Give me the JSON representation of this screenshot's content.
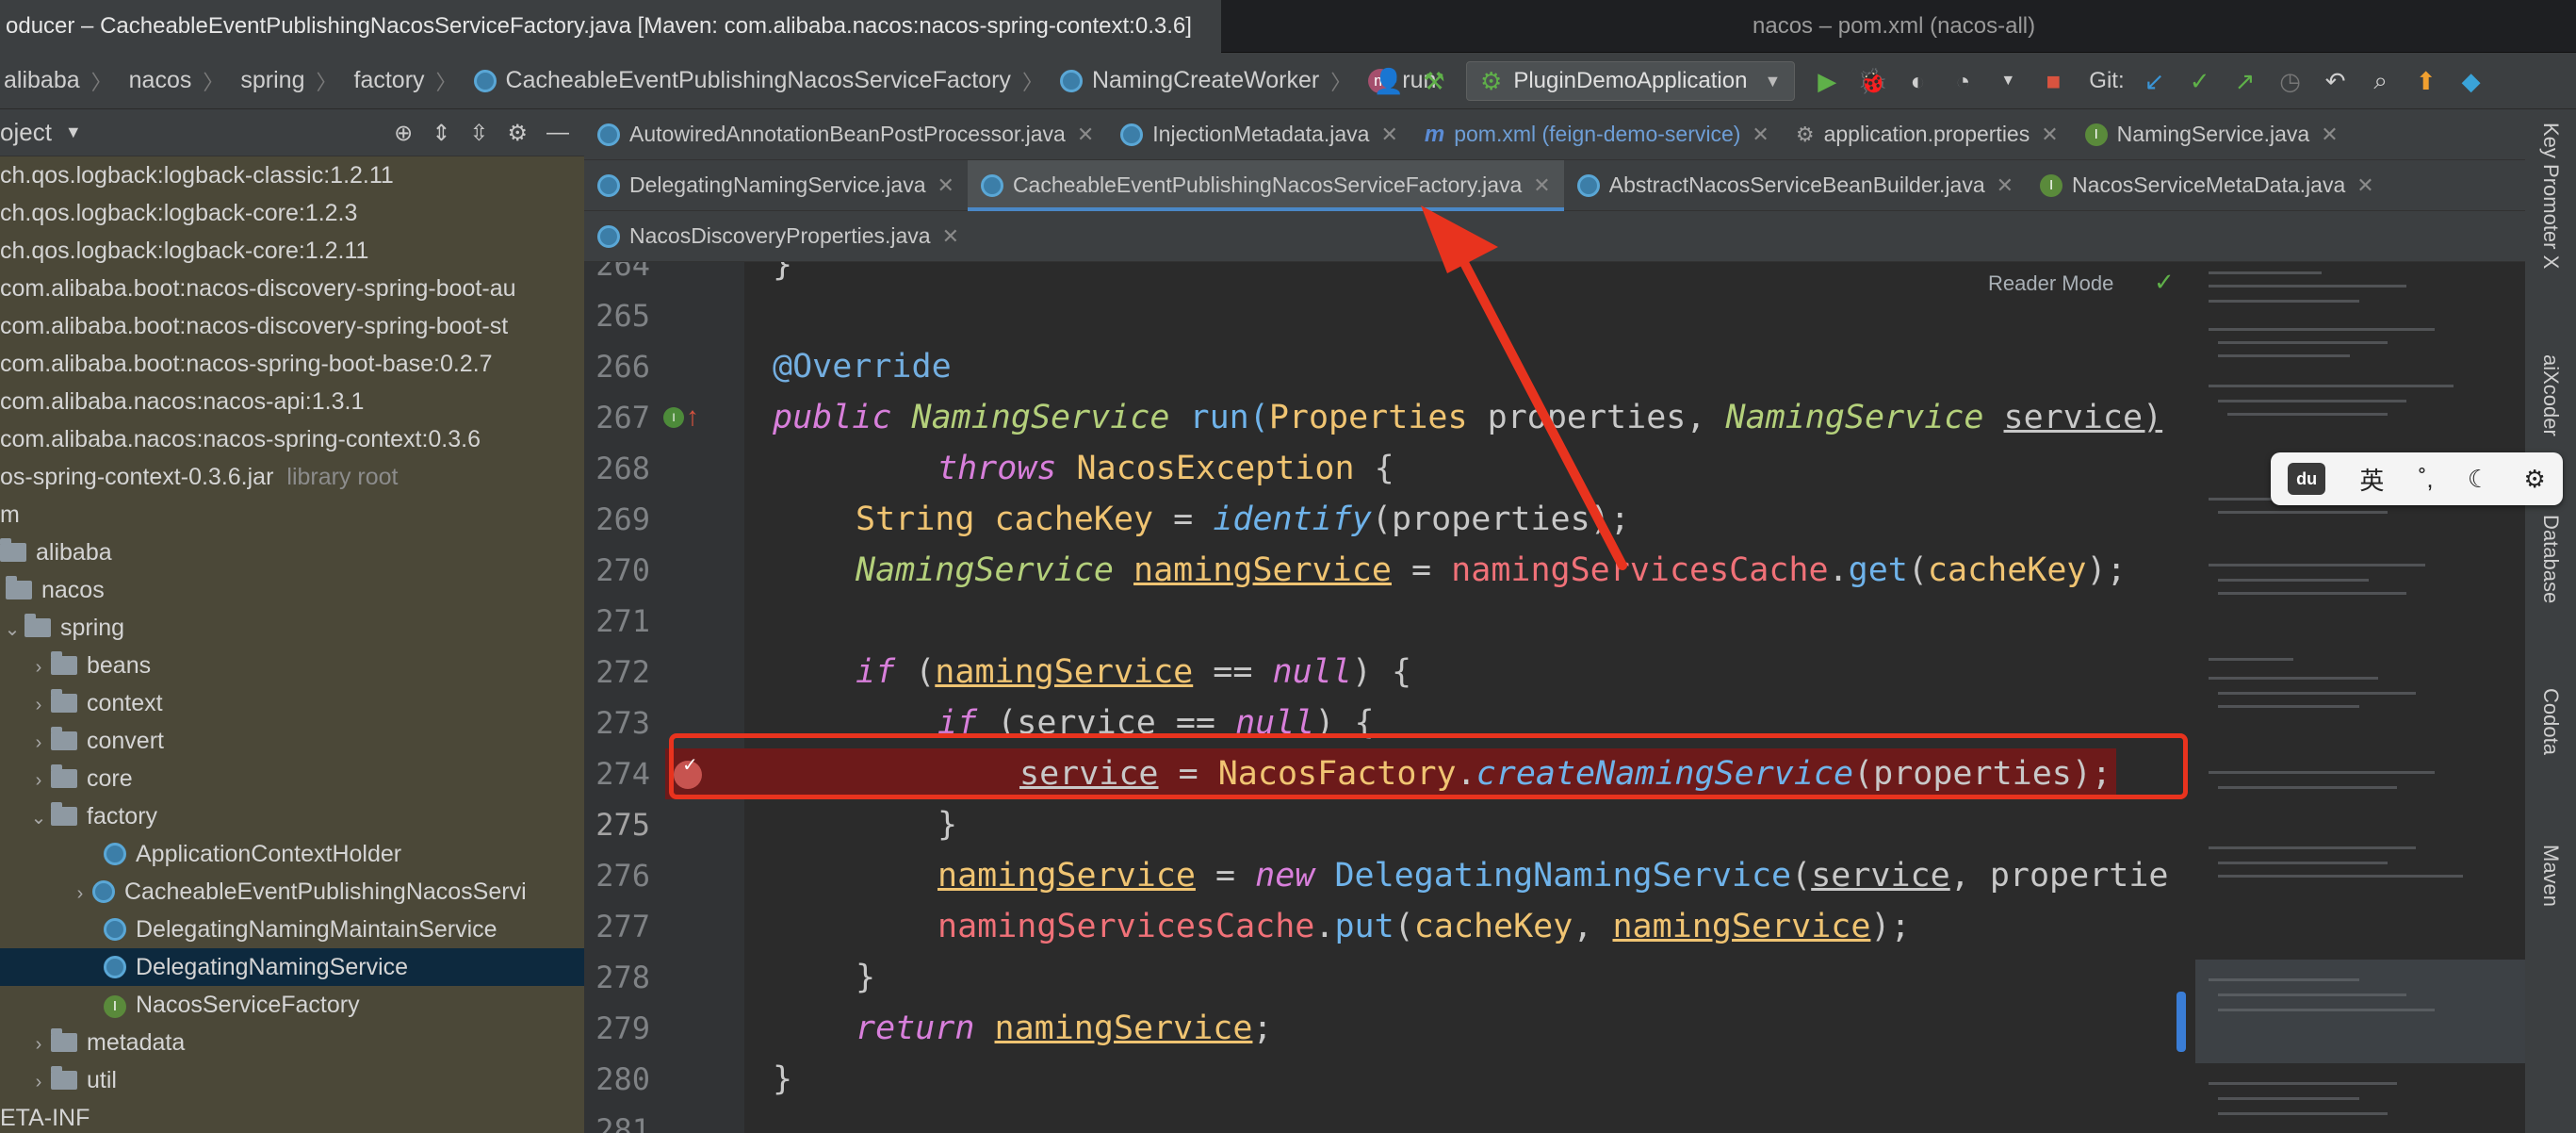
{
  "window": {
    "title": "oducer – CacheableEventPublishingNacosServiceFactory.java [Maven: com.alibaba.nacos:nacos-spring-context:0.3.6]",
    "right_title": "nacos – pom.xml (nacos-all)"
  },
  "breadcrumbs": [
    "alibaba",
    "nacos",
    "spring",
    "factory",
    "CacheableEventPublishingNacosServiceFactory",
    "NamingCreateWorker",
    "run"
  ],
  "toolbar": {
    "run_config": "PluginDemoApplication",
    "git_label": "Git:"
  },
  "project": {
    "title": "oject",
    "rows": [
      {
        "text": "ch.qos.logback:logback-classic:1.2.11",
        "type": "lib"
      },
      {
        "text": "ch.qos.logback:logback-core:1.2.3",
        "type": "lib"
      },
      {
        "text": "ch.qos.logback:logback-core:1.2.11",
        "type": "lib"
      },
      {
        "text": "com.alibaba.boot:nacos-discovery-spring-boot-au",
        "type": "lib"
      },
      {
        "text": "com.alibaba.boot:nacos-discovery-spring-boot-st",
        "type": "lib"
      },
      {
        "text": "com.alibaba.boot:nacos-spring-boot-base:0.2.7",
        "type": "lib"
      },
      {
        "text": "com.alibaba.nacos:nacos-api:1.3.1",
        "type": "lib"
      },
      {
        "text": "com.alibaba.nacos:nacos-spring-context:0.3.6",
        "type": "lib"
      },
      {
        "text": "os-spring-context-0.3.6.jar",
        "type": "lib",
        "muted": "library root"
      },
      {
        "text": "m",
        "type": "lib"
      },
      {
        "text": "alibaba",
        "type": "lib"
      },
      {
        "text": "nacos",
        "type": "lib"
      },
      {
        "text": "spring",
        "type": "lib"
      },
      {
        "text": "beans",
        "type": "lib"
      },
      {
        "text": "context",
        "type": "lib"
      },
      {
        "text": "convert",
        "type": "lib"
      },
      {
        "text": "core",
        "type": "lib"
      },
      {
        "text": "factory",
        "type": "lib"
      },
      {
        "text": "ApplicationContextHolder",
        "type": "lib"
      },
      {
        "text": "CacheableEventPublishingNacosServi",
        "type": "lib"
      },
      {
        "text": "DelegatingNamingMaintainService",
        "type": "lib"
      },
      {
        "text": "DelegatingNamingService",
        "type": "sel"
      },
      {
        "text": "NacosServiceFactory",
        "type": "lib"
      },
      {
        "text": "metadata",
        "type": "lib"
      },
      {
        "text": "util",
        "type": "lib"
      },
      {
        "text": "ETA-INF",
        "type": "lib"
      }
    ]
  },
  "tabs": {
    "row1": [
      "AutowiredAnnotationBeanPostProcessor.java",
      "InjectionMetadata.java",
      "pom.xml (feign-demo-service)",
      "application.properties",
      "NamingService.java"
    ],
    "row2": [
      "DelegatingNamingService.java",
      "CacheableEventPublishingNacosServiceFactory.java",
      "AbstractNacosServiceBeanBuilder.java",
      "NacosServiceMetaData.java"
    ],
    "row3": [
      "NacosDiscoveryProperties.java"
    ]
  },
  "editor": {
    "reader_mode": "Reader Mode",
    "line_numbers": [
      "264",
      "265",
      "266",
      "267",
      "268",
      "269",
      "270",
      "271",
      "272",
      "273",
      "274",
      "275",
      "276",
      "277",
      "278",
      "279",
      "280",
      "281"
    ],
    "lines": {
      "l266": "@Override",
      "l267_a": "public ",
      "l267_b": "NamingService ",
      "l267_c": "run(",
      "l267_d": "Properties ",
      "l267_e": "properties, ",
      "l267_f": "NamingService ",
      "l267_g": "service)",
      "l268_a": "throws ",
      "l268_b": "NacosException ",
      "l268_c": "{",
      "l269_a": "String ",
      "l269_b": "cacheKey ",
      "l269_c": "= ",
      "l269_d": "identify",
      "l269_e": "(properties);",
      "l270_a": "NamingService ",
      "l270_b": "namingService",
      "l270_c": " = ",
      "l270_d": "namingServicesCache",
      "l270_e": ".",
      "l270_f": "get",
      "l270_g": "(",
      "l270_h": "cacheKey",
      "l270_i": ");",
      "l272_a": "if ",
      "l272_b": "(",
      "l272_c": "namingService",
      "l272_d": " == ",
      "l272_e": "null",
      "l272_f": ") {",
      "l273_a": "if ",
      "l273_b": "(service == ",
      "l273_c": "null",
      "l273_d": ") {",
      "l274_a": "service",
      "l274_b": " = ",
      "l274_c": "NacosFactory",
      "l274_d": ".",
      "l274_e": "createNamingService",
      "l274_f": "(properties);",
      "l275": "}",
      "l276_a": "namingService",
      "l276_b": " = ",
      "l276_c": "new ",
      "l276_d": "DelegatingNamingService",
      "l276_e": "(",
      "l276_f": "service",
      "l276_g": ", propertie",
      "l277_a": "namingServicesCache",
      "l277_b": ".",
      "l277_c": "put",
      "l277_d": "(",
      "l277_e": "cacheKey",
      "l277_f": ", ",
      "l277_g": "namingService",
      "l277_h": ");",
      "l278": "}",
      "l279_a": "return ",
      "l279_b": "namingService",
      "l279_c": ";",
      "l280": "}"
    }
  },
  "right_strip": [
    "Key Promoter X",
    "aiXcoder",
    "Database",
    "Codota",
    "Maven"
  ],
  "ime": {
    "label": "du",
    "lang": "英"
  }
}
